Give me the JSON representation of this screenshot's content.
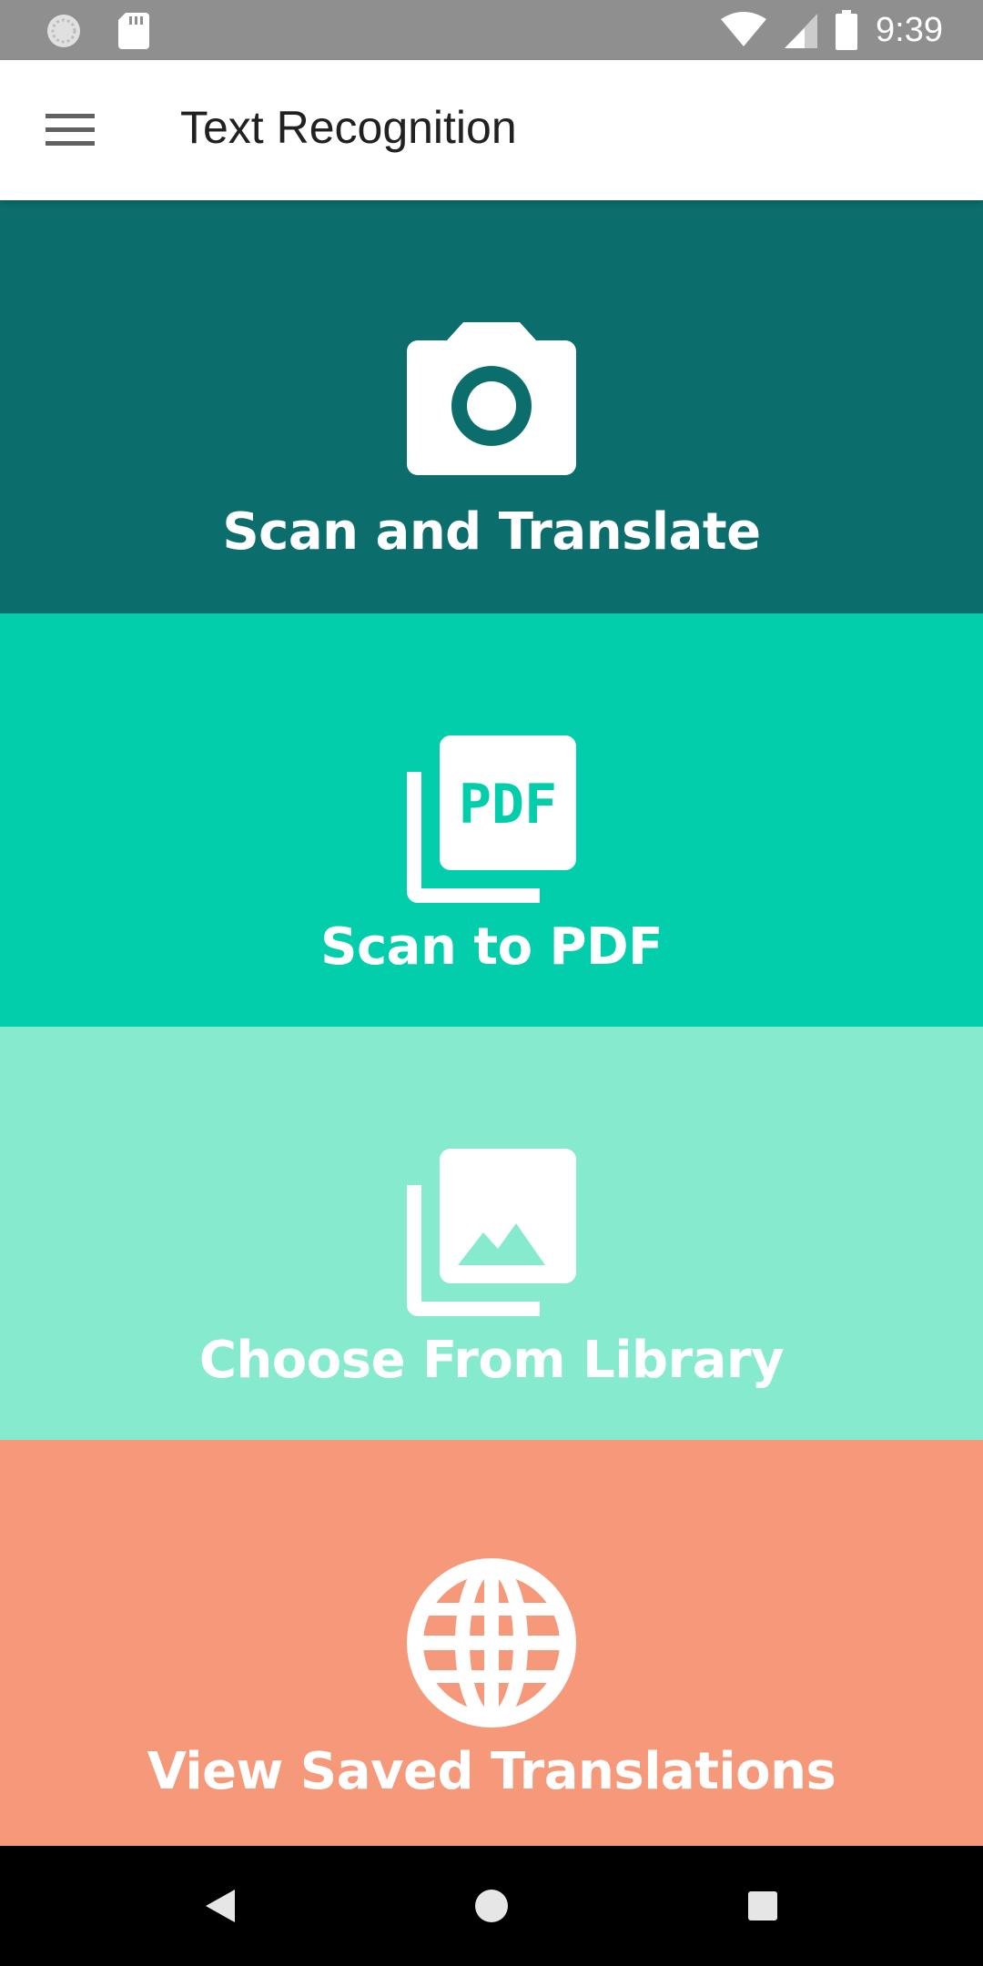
{
  "status_bar": {
    "time": "9:39",
    "icons": [
      "sync-icon",
      "sd-card-icon",
      "wifi-icon",
      "signal-icon",
      "battery-icon"
    ]
  },
  "app_bar": {
    "title": "Text Recognition",
    "menu_icon": "hamburger-menu-icon"
  },
  "tiles": [
    {
      "label": "Scan and Translate",
      "icon": "camera-icon",
      "color": "#0b6e6c"
    },
    {
      "label": "Scan to PDF",
      "icon": "pdf-icon",
      "icon_text": "PDF",
      "color": "#02ceac"
    },
    {
      "label": "Choose From Library",
      "icon": "photo-library-icon",
      "color": "#86ebce"
    },
    {
      "label": "View Saved Translations",
      "icon": "globe-icon",
      "color": "#f6987a"
    }
  ],
  "nav_bar": {
    "buttons": [
      "back-icon",
      "home-icon",
      "recents-icon"
    ]
  }
}
